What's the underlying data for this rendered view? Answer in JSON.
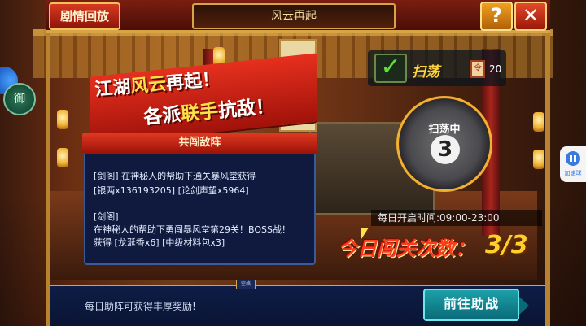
{
  "header": {
    "replay_label": "剧情回放",
    "title": "风云再起",
    "help_label": "?",
    "close_label": "✕"
  },
  "slogan": {
    "line1_a": "江湖",
    "line1_b": "风云",
    "line1_c": "再起！",
    "line2_a": "各派",
    "line2_b": "联手",
    "line2_c": "抗敌！"
  },
  "panel": {
    "title": "共闯敌阵",
    "logs": [
      "[剑阁] 在神秘人的帮助下通关暴风堂获得",
      "[银两x136193205] [论剑声望x5964]",
      "[剑阁]",
      "在神秘人的帮助下勇闯暴风堂第29关！BOSS战！",
      "获得 [龙涎香x6] [中级材料包x3]"
    ]
  },
  "sweep": {
    "label": "扫荡",
    "token_count": "20",
    "status": "扫荡中",
    "number": "3",
    "open_time": "每日开启时间:09:00-23:00",
    "today_label": "今日闯关次数：",
    "today_count": "3/3"
  },
  "footer": {
    "tab_label": "空格",
    "help_text": "每日助阵可获得丰厚奖励!",
    "assist_label": "前往助战"
  },
  "side": {
    "left_icon_2_glyph": "御",
    "right_widget_label": "加速球"
  },
  "colors": {
    "accent_gold": "#d7a547",
    "panel_blue": "#0f1a3e",
    "banner_red": "#e6301e",
    "assist_teal": "#1ca0a8"
  },
  "icons": {
    "check": "check-icon",
    "token": "sweep-token-icon",
    "help": "question-icon",
    "close": "close-icon"
  }
}
